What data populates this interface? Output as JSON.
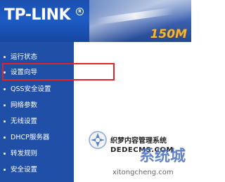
{
  "header": {
    "logo": "TP-LINK",
    "logo_mark": "R",
    "model": "150M"
  },
  "sidebar": {
    "items": [
      {
        "label": "运行状态"
      },
      {
        "label": "设置向导"
      },
      {
        "label": "QSS安全设置"
      },
      {
        "label": "网络参数"
      },
      {
        "label": "无线设置"
      },
      {
        "label": "DHCP服务器"
      },
      {
        "label": "转发规则"
      },
      {
        "label": "安全设置"
      }
    ]
  },
  "watermark": {
    "line1": "织梦内容管理系统",
    "line2": "DEDECMS.COM",
    "big": "系统城",
    "url": "xitongcheng.com"
  },
  "colors": {
    "sidebar_bg": "#1f4fa6",
    "header_bg": "#1e5cc4",
    "highlight": "#e0242b",
    "model_text": "#f3b53a"
  }
}
